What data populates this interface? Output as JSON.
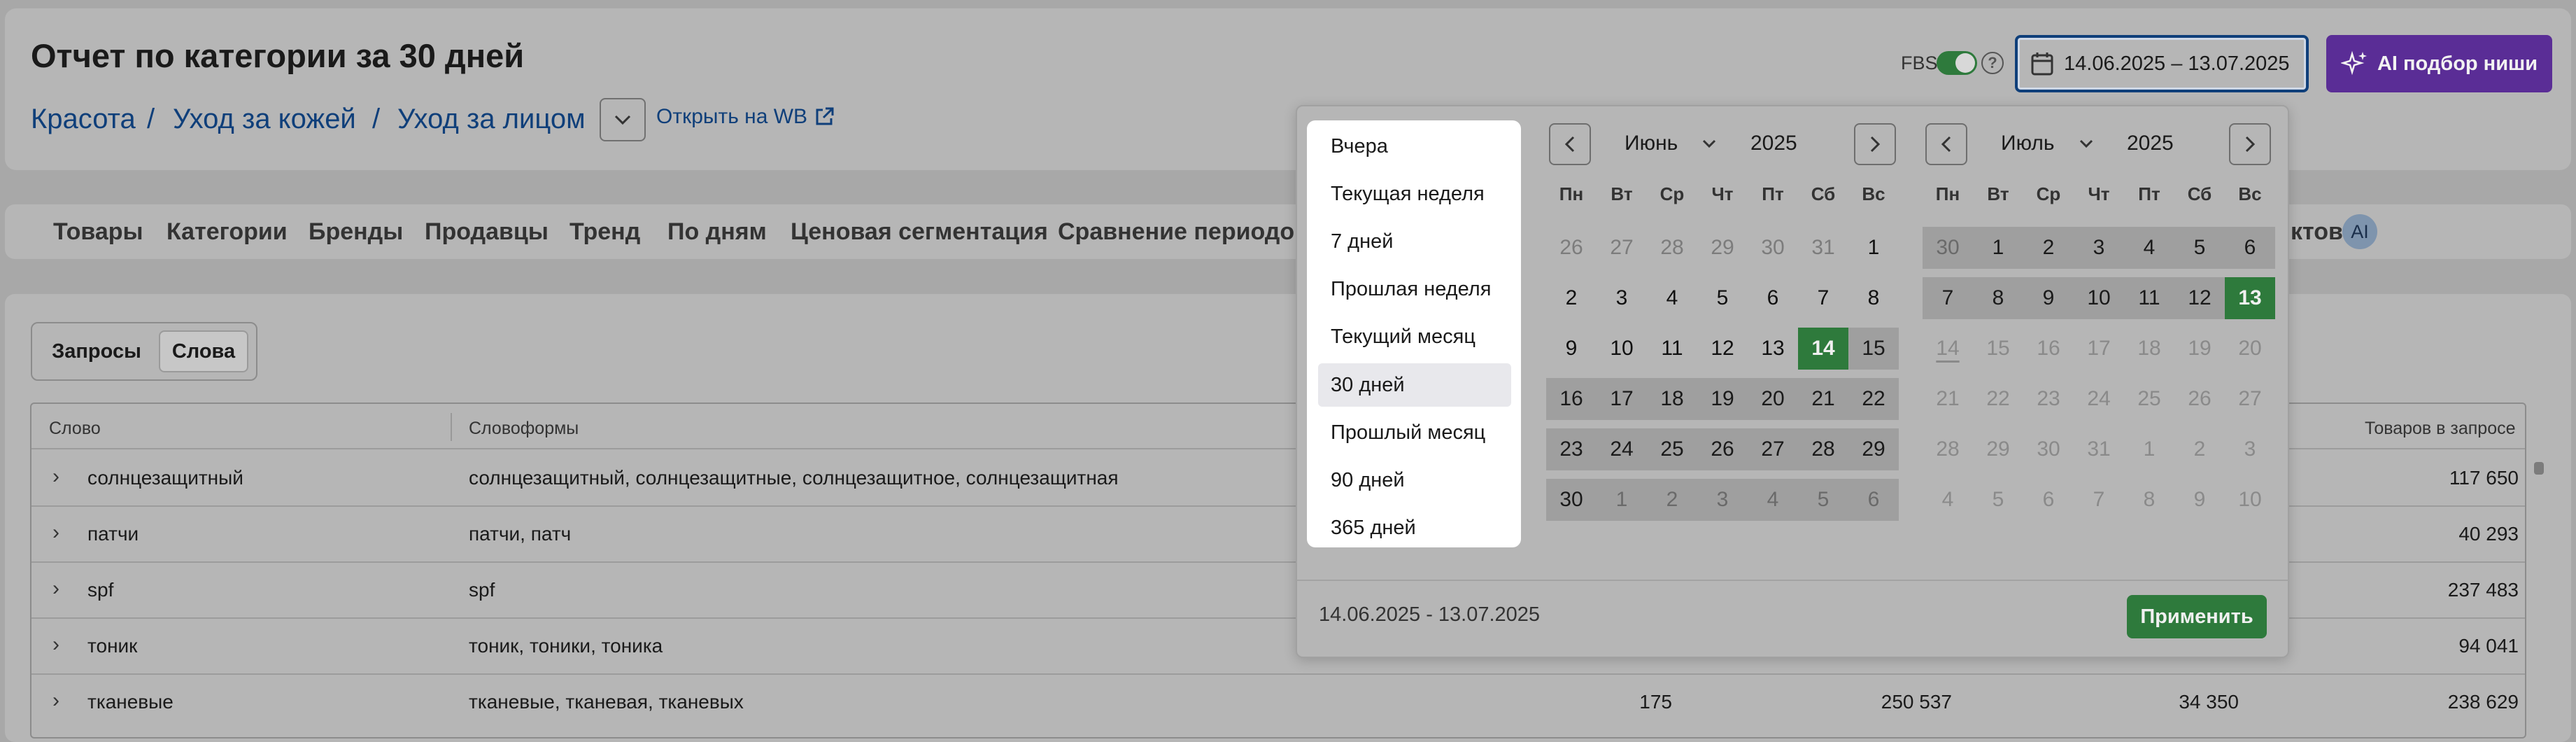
{
  "header": {
    "title": "Отчет по категории за 30 дней",
    "breadcrumb": [
      "Красота",
      "Уход за кожей",
      "Уход за лицом"
    ],
    "breadcrumb_sep": "/",
    "open_wb": "Открыть на WB",
    "fbs_label": "FBS",
    "fbs_enabled": true,
    "date_range": "14.06.2025 – 13.07.2025",
    "ai_button": "AI подбор ниши",
    "colors": {
      "accent": "#0f3f7a",
      "ai_button": "#5a2d96",
      "toggle": "#2e7a3c"
    }
  },
  "tabs": [
    "Товары",
    "Категории",
    "Бренды",
    "Продавцы",
    "Тренд",
    "По дням",
    "Ценовая сегментация",
    "Сравнение периодов"
  ],
  "tabs_clipped": {
    "partial_label": "ктов",
    "badge": "AI"
  },
  "segment": {
    "options": [
      "Запросы",
      "Слова"
    ],
    "active": "Слова"
  },
  "table": {
    "columns": {
      "word": "Слово",
      "forms": "Словоформы",
      "goods": "Товаров в запросе"
    },
    "rows": [
      {
        "word": "солнцезащитный",
        "forms": "солнцезащитный, солнцезащитные, солнцезащитное, солнцезащитная",
        "goods": "117 650"
      },
      {
        "word": "патчи",
        "forms": "патчи, патч",
        "goods": "40 293"
      },
      {
        "word": "spf",
        "forms": "spf",
        "goods": "237 483"
      },
      {
        "word": "тоник",
        "forms": "тоник, тоники, тоника",
        "goods": "94 041"
      },
      {
        "word": "тканевые",
        "forms": "тканевые, тканевая, тканевых",
        "c1": "175",
        "c2": "250 537",
        "c3": "34 350",
        "goods": "238 629"
      }
    ]
  },
  "datepicker": {
    "presets": [
      "Вчера",
      "Текущая неделя",
      "7 дней",
      "Прошлая неделя",
      "Текущий месяц",
      "30 дней",
      "Прошлый месяц",
      "90 дней",
      "365 дней"
    ],
    "active_preset": "30 дней",
    "weekdays": [
      "Пн",
      "Вт",
      "Ср",
      "Чт",
      "Пт",
      "Сб",
      "Вс"
    ],
    "left": {
      "month": "Июнь",
      "year": "2025"
    },
    "right": {
      "month": "Июль",
      "year": "2025"
    },
    "range_text": "14.06.2025 - 13.07.2025",
    "apply": "Применить",
    "left_days": [
      [
        "26",
        "27",
        "28",
        "29",
        "30",
        "31",
        "1"
      ],
      [
        "2",
        "3",
        "4",
        "5",
        "6",
        "7",
        "8"
      ],
      [
        "9",
        "10",
        "11",
        "12",
        "13",
        "14",
        "15"
      ],
      [
        "16",
        "17",
        "18",
        "19",
        "20",
        "21",
        "22"
      ],
      [
        "23",
        "24",
        "25",
        "26",
        "27",
        "28",
        "29"
      ],
      [
        "30",
        "1",
        "2",
        "3",
        "4",
        "5",
        "6"
      ]
    ],
    "right_days": [
      [
        "30",
        "1",
        "2",
        "3",
        "4",
        "5",
        "6"
      ],
      [
        "7",
        "8",
        "9",
        "10",
        "11",
        "12",
        "13"
      ],
      [
        "14",
        "15",
        "16",
        "17",
        "18",
        "19",
        "20"
      ],
      [
        "21",
        "22",
        "23",
        "24",
        "25",
        "26",
        "27"
      ],
      [
        "28",
        "29",
        "30",
        "31",
        "1",
        "2",
        "3"
      ],
      [
        "4",
        "5",
        "6",
        "7",
        "8",
        "9",
        "10"
      ]
    ]
  }
}
